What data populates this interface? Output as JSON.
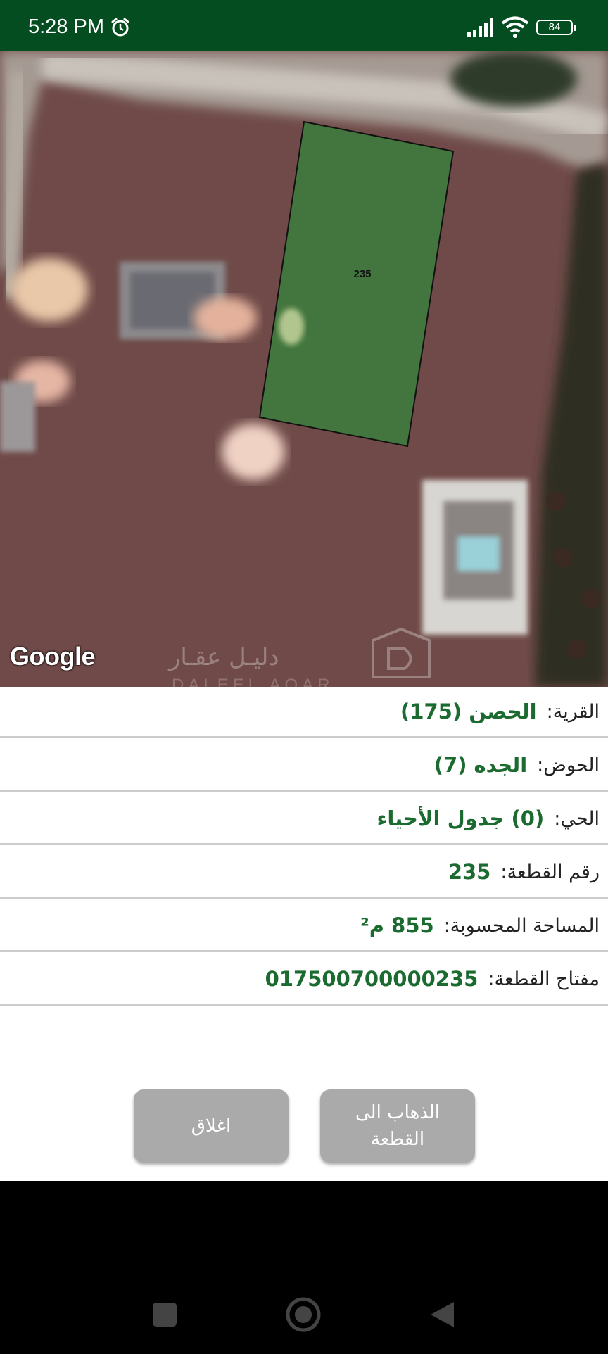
{
  "status_bar": {
    "time": "5:28 PM",
    "battery": "84",
    "icons": [
      "alarm-icon",
      "signal-icon",
      "wifi-icon",
      "battery-icon"
    ]
  },
  "map": {
    "parcel_label": "235",
    "google_label": "Google",
    "watermark": "دليـل عقـار",
    "watermark_latin": "DALEEL AQAR",
    "parcel_fill": "#3f7a3e"
  },
  "info": {
    "village": {
      "label": "القرية:",
      "value": "الحصن (175)"
    },
    "basin": {
      "label": "الحوض:",
      "value": "الجده (7)"
    },
    "neighborhood": {
      "label": "الحي:",
      "value": "(0) جدول الأحياء"
    },
    "parcel_number": {
      "label": "رقم القطعة:",
      "value": "235"
    },
    "area": {
      "label": "المساحة المحسوبة:",
      "value": "855 م²"
    },
    "parcel_key": {
      "label": "مفتاح القطعة:",
      "value": "017500700000235"
    }
  },
  "buttons": {
    "go_to_parcel_line1": "الذهاب الى",
    "go_to_parcel_line2": "القطعة",
    "close": "اغلاق"
  },
  "colors": {
    "status_bar": "#044d20",
    "value_text": "#1b6b30",
    "button": "#aaaaaa"
  }
}
